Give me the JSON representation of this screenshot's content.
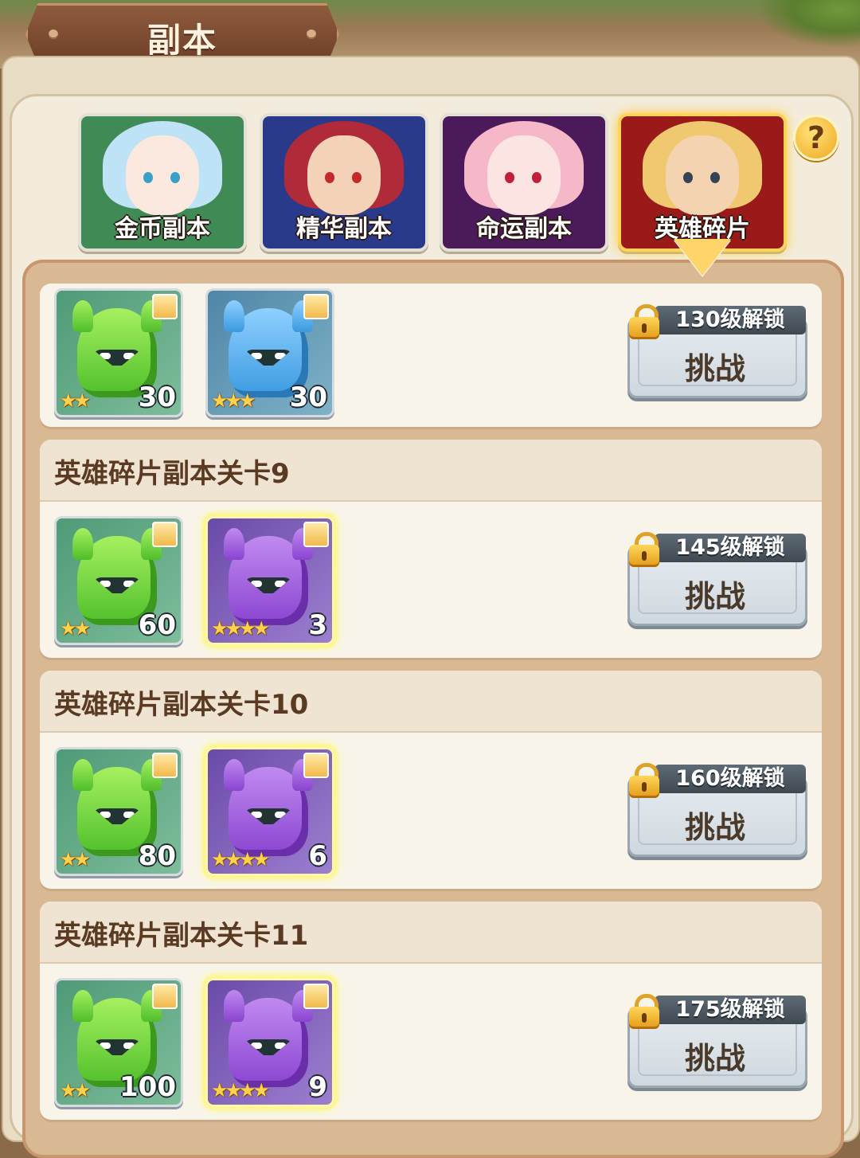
{
  "header": {
    "title": "副本"
  },
  "tabs": [
    {
      "label": "金币副本",
      "active": false,
      "portrait": {
        "bg": "#3f8a55",
        "hair": "#bfe3f6",
        "skin": "#fbe9df",
        "eye": "#3aa0c8"
      }
    },
    {
      "label": "精华副本",
      "active": false,
      "portrait": {
        "bg": "#2a3a8a",
        "hair": "#b02a3a",
        "skin": "#f4d2b8",
        "eye": "#c02a2a"
      }
    },
    {
      "label": "命运副本",
      "active": false,
      "portrait": {
        "bg": "#4a1a5a",
        "hair": "#f6b8c8",
        "skin": "#fbe4e2",
        "eye": "#c0203a"
      }
    },
    {
      "label": "英雄碎片",
      "active": true,
      "portrait": {
        "bg": "#9a1a1a",
        "hair": "#f0c870",
        "skin": "#f4d4b0",
        "eye": "#334455"
      }
    }
  ],
  "help": {
    "label": "?"
  },
  "stages": [
    {
      "title": "",
      "rewards": [
        {
          "color": "green",
          "stars": "★★",
          "count": "30"
        },
        {
          "color": "blue",
          "stars": "★★★",
          "count": "30"
        }
      ],
      "unlock": "130级解锁",
      "button": "挑战"
    },
    {
      "title": "英雄碎片副本关卡9",
      "rewards": [
        {
          "color": "green",
          "stars": "★★",
          "count": "60"
        },
        {
          "color": "purple",
          "stars": "★★★★",
          "count": "3"
        }
      ],
      "unlock": "145级解锁",
      "button": "挑战"
    },
    {
      "title": "英雄碎片副本关卡10",
      "rewards": [
        {
          "color": "green",
          "stars": "★★",
          "count": "80"
        },
        {
          "color": "purple",
          "stars": "★★★★",
          "count": "6"
        }
      ],
      "unlock": "160级解锁",
      "button": "挑战"
    },
    {
      "title": "英雄碎片副本关卡11",
      "rewards": [
        {
          "color": "green",
          "stars": "★★",
          "count": "100"
        },
        {
          "color": "purple",
          "stars": "★★★★",
          "count": "9"
        }
      ],
      "unlock": "175级解锁",
      "button": "挑战"
    }
  ]
}
